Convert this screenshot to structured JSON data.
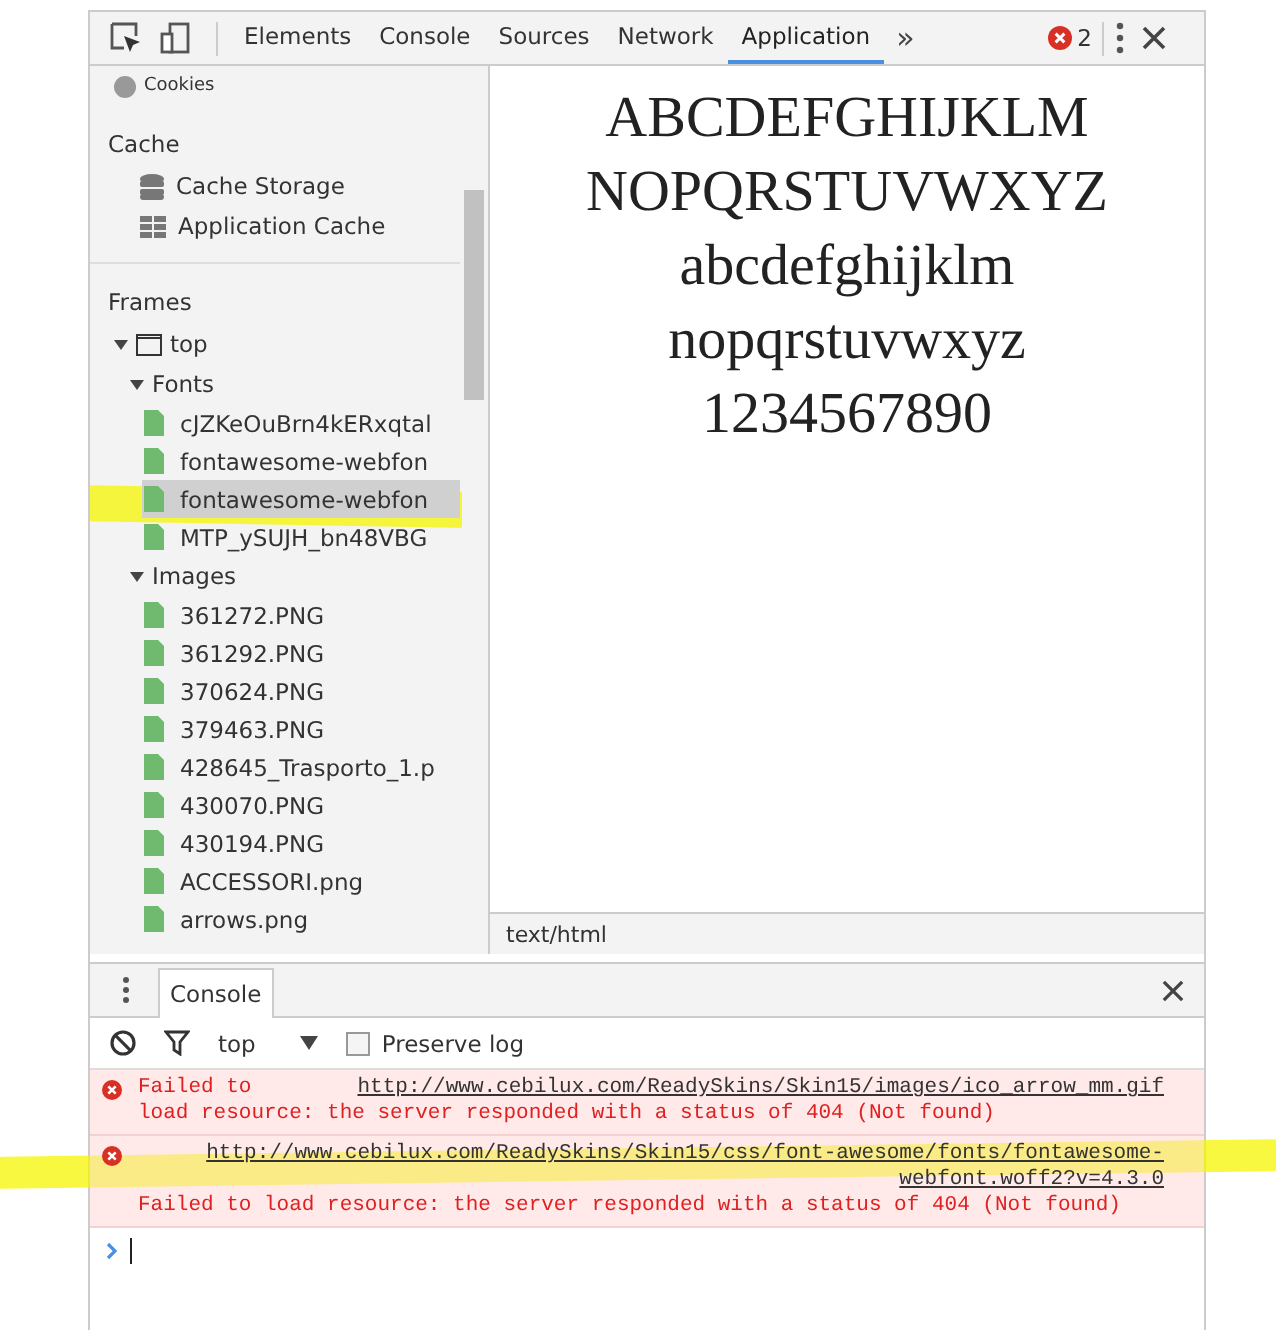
{
  "toolbar": {
    "tabs": [
      {
        "label": "Elements",
        "selected": false
      },
      {
        "label": "Console",
        "selected": false
      },
      {
        "label": "Sources",
        "selected": false
      },
      {
        "label": "Network",
        "selected": false
      },
      {
        "label": "Application",
        "selected": true
      }
    ],
    "more": "»",
    "error_count": "2"
  },
  "sidebar": {
    "cut_item": "Cookies",
    "sections": [
      {
        "title": "Cache",
        "items": [
          {
            "label": "Cache Storage",
            "kind": "database"
          },
          {
            "label": "Application Cache",
            "kind": "grid"
          }
        ]
      }
    ],
    "frames": {
      "title": "Frames",
      "tree": [
        {
          "label": "top",
          "kind": "frame",
          "expanded": true,
          "children": [
            {
              "label": "Fonts",
              "expanded": true,
              "children": [
                {
                  "label": "cJZKeOuBrn4kERxqtal",
                  "kind": "file",
                  "selected": false,
                  "highlighted": false
                },
                {
                  "label": "fontawesome-webfon",
                  "kind": "file",
                  "selected": false,
                  "highlighted": false
                },
                {
                  "label": "fontawesome-webfon",
                  "kind": "file",
                  "selected": true,
                  "highlighted": true
                },
                {
                  "label": "MTP_ySUJH_bn48VBG",
                  "kind": "file",
                  "selected": false,
                  "highlighted": false
                }
              ]
            },
            {
              "label": "Images",
              "expanded": true,
              "children": [
                {
                  "label": "361272.PNG",
                  "kind": "file",
                  "selected": false,
                  "highlighted": false
                },
                {
                  "label": "361292.PNG",
                  "kind": "file",
                  "selected": false,
                  "highlighted": false
                },
                {
                  "label": "370624.PNG",
                  "kind": "file",
                  "selected": false,
                  "highlighted": false
                },
                {
                  "label": "379463.PNG",
                  "kind": "file",
                  "selected": false,
                  "highlighted": false
                },
                {
                  "label": "428645_Trasporto_1.p",
                  "kind": "file",
                  "selected": false,
                  "highlighted": false
                },
                {
                  "label": "430070.PNG",
                  "kind": "file",
                  "selected": false,
                  "highlighted": false
                },
                {
                  "label": "430194.PNG",
                  "kind": "file",
                  "selected": false,
                  "highlighted": false
                },
                {
                  "label": "ACCESSORI.png",
                  "kind": "file",
                  "selected": false,
                  "highlighted": false
                },
                {
                  "label": "arrows.png",
                  "kind": "file",
                  "selected": false,
                  "highlighted": false
                }
              ]
            }
          ]
        }
      ]
    }
  },
  "preview": {
    "lines": [
      "ABCDEFGHIJKLM",
      "NOPQRSTUVWXYZ",
      "abcdefghijklm",
      "nopqrstuvwxyz",
      "1234567890"
    ],
    "status": "text/html"
  },
  "drawer": {
    "tab": "Console",
    "context": "top",
    "preserve_log": {
      "label": "Preserve log",
      "checked": false
    },
    "messages": [
      {
        "kind": "error",
        "prefix": "Failed to",
        "url": "http://www.cebilux.com/ReadySkins/Skin15/images/ico_arrow_mm.gif",
        "text": "load resource: the server responded with a status of 404 (Not found)",
        "highlighted": false
      },
      {
        "kind": "error",
        "url": "http://www.cebilux.com/ReadySkins/Skin15/css/font-awesome/fonts/fontawesome-webfont.woff2?v=4.3.0",
        "text": "Failed to load resource: the server responded with a status of 404 (Not found)",
        "highlighted": true
      }
    ]
  }
}
